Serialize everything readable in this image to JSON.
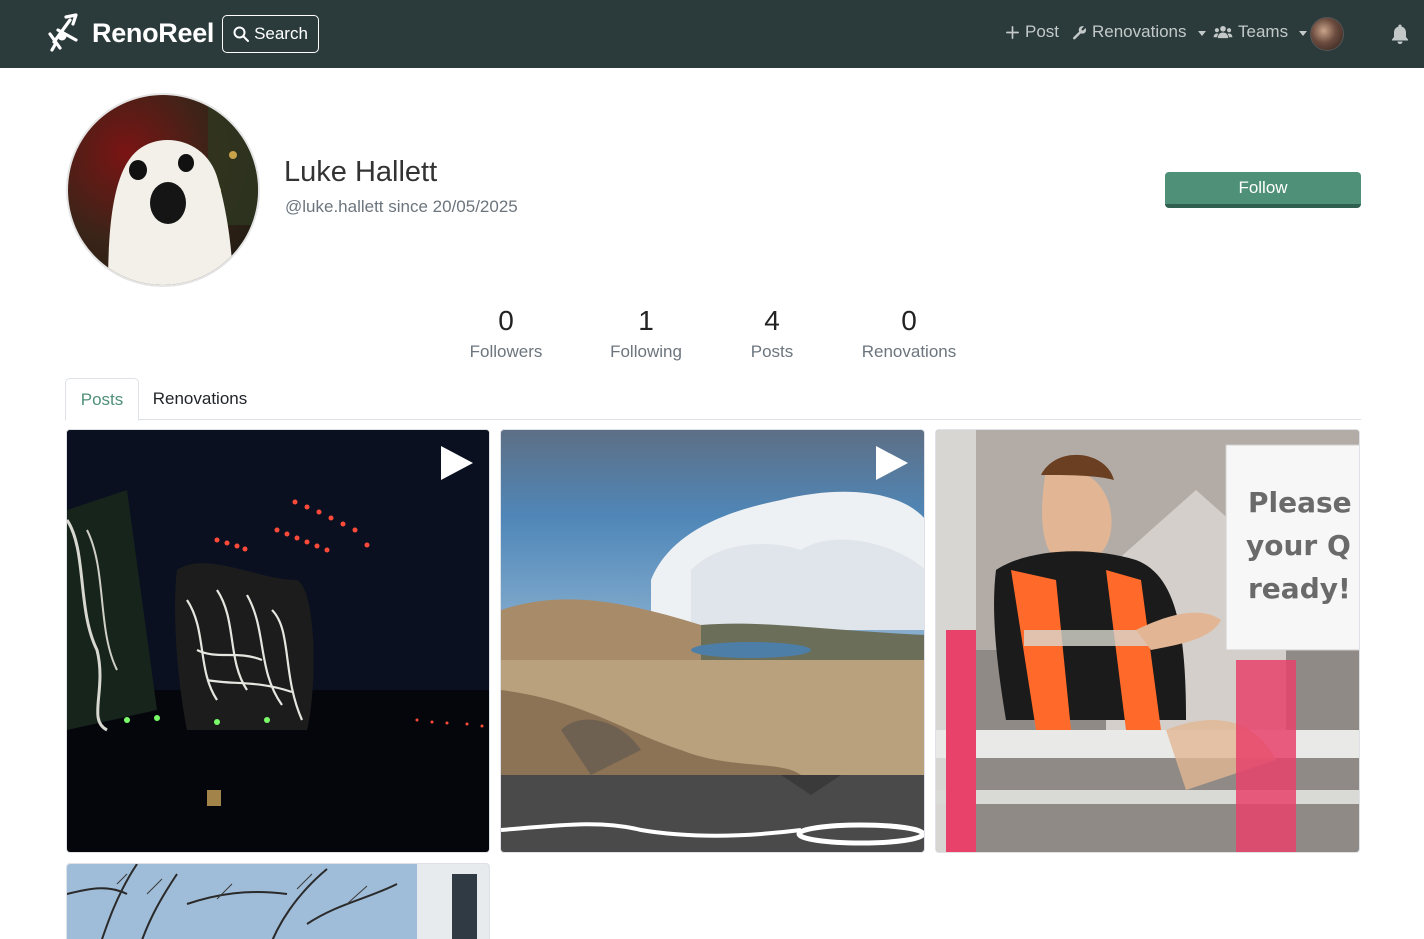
{
  "nav": {
    "brand": "RenoReel",
    "search_label": "Search",
    "post_label": "Post",
    "renovations_label": "Renovations",
    "teams_label": "Teams"
  },
  "profile": {
    "name": "Luke Hallett",
    "handle": "@luke.hallett since 20/05/2025",
    "follow_label": "Follow"
  },
  "stats": [
    {
      "value": "0",
      "label": "Followers"
    },
    {
      "value": "1",
      "label": "Following"
    },
    {
      "value": "4",
      "label": "Posts"
    },
    {
      "value": "0",
      "label": "Renovations"
    }
  ],
  "tabs": {
    "posts": "Posts",
    "renovations": "Renovations"
  },
  "posts": [
    {
      "kind": "video"
    },
    {
      "kind": "video"
    },
    {
      "kind": "image",
      "overlay": [
        "Please",
        "your Q",
        "ready!"
      ]
    },
    {
      "kind": "image"
    }
  ],
  "colors": {
    "navbar": "#2b3a3a",
    "accent": "#4f9078"
  }
}
